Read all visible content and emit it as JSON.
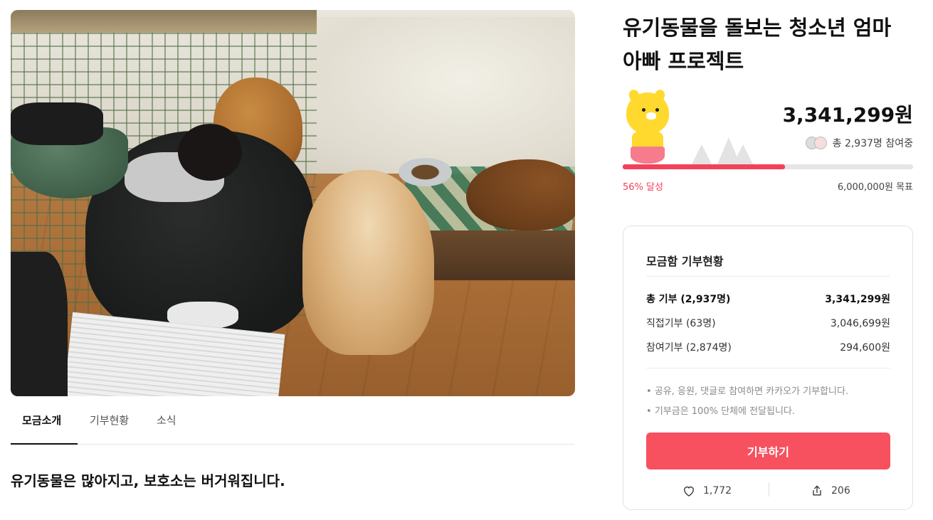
{
  "campaign": {
    "title": "유기동물을 돌보는 청소년 엄마 아빠 프로젝트",
    "amount": "3,341,299원",
    "participants": "총 2,937명 참여중",
    "progress_percent": 56,
    "progress_label": "56% 달성",
    "goal": "6,000,000원 목표"
  },
  "tabs": [
    {
      "label": "모금소개",
      "active": true
    },
    {
      "label": "기부현황",
      "active": false
    },
    {
      "label": "소식",
      "active": false
    }
  ],
  "intro": {
    "heading": "유기동물은 많아지고, 보호소는 버거워집니다."
  },
  "donation_card": {
    "title": "모금함 기부현황",
    "rows": [
      {
        "label": "총 기부 (2,937명)",
        "value": "3,341,299원"
      },
      {
        "label": "직접기부 (63명)",
        "value": "3,046,699원"
      },
      {
        "label": "참여기부 (2,874명)",
        "value": "294,600원"
      }
    ],
    "notes": [
      "공유, 응원, 댓글로 참여하면 카카오가 기부합니다.",
      "기부금은 100% 단체에 전달됩니다."
    ],
    "donate_button": "기부하기",
    "likes": "1,772",
    "shares": "206"
  },
  "colors": {
    "accent": "#f4415a",
    "button": "#f7515f"
  },
  "icons": {
    "like": "heart-icon",
    "share": "share-icon"
  }
}
